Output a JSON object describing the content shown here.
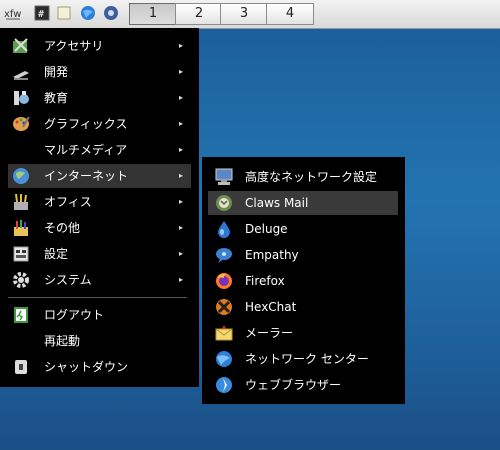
{
  "taskbar": {
    "launchers": [
      {
        "icon": "whisker-menu-icon"
      },
      {
        "icon": "terminal-icon"
      },
      {
        "icon": "file-manager-icon"
      },
      {
        "icon": "web-browser-icon"
      },
      {
        "icon": "settings-icon"
      }
    ],
    "workspaces": [
      {
        "label": "1",
        "active": true
      },
      {
        "label": "2",
        "active": false
      },
      {
        "label": "3",
        "active": false
      },
      {
        "label": "4",
        "active": false
      }
    ]
  },
  "main_menu": {
    "items": [
      {
        "label": "アクセサリ",
        "icon": "accessories-icon",
        "submenu": true
      },
      {
        "label": "開発",
        "icon": "development-icon",
        "submenu": true
      },
      {
        "label": "教育",
        "icon": "education-icon",
        "submenu": true
      },
      {
        "label": "グラフィックス",
        "icon": "graphics-icon",
        "submenu": true
      },
      {
        "label": "マルチメディア",
        "icon": "",
        "submenu": true
      },
      {
        "label": "インターネット",
        "icon": "internet-icon",
        "submenu": true,
        "highlighted": true
      },
      {
        "label": "オフィス",
        "icon": "office-icon",
        "submenu": true
      },
      {
        "label": "その他",
        "icon": "other-icon",
        "submenu": true
      },
      {
        "label": "設定",
        "icon": "settings-icon",
        "submenu": true
      },
      {
        "label": "システム",
        "icon": "system-icon",
        "submenu": true
      }
    ],
    "session": [
      {
        "label": "ログアウト",
        "icon": "logout-icon"
      },
      {
        "label": "再起動",
        "icon": ""
      },
      {
        "label": "シャットダウン",
        "icon": "shutdown-icon"
      }
    ],
    "arrow": "▸"
  },
  "internet_submenu": {
    "items": [
      {
        "label": "高度なネットワーク設定",
        "icon": "network-settings-icon"
      },
      {
        "label": "Claws Mail",
        "icon": "claws-mail-icon",
        "highlighted": true
      },
      {
        "label": "Deluge",
        "icon": "deluge-icon"
      },
      {
        "label": "Empathy",
        "icon": "empathy-icon"
      },
      {
        "label": "Firefox",
        "icon": "firefox-icon"
      },
      {
        "label": "HexChat",
        "icon": "hexchat-icon"
      },
      {
        "label": "メーラー",
        "icon": "mailer-icon"
      },
      {
        "label": "ネットワーク センター",
        "icon": "network-center-icon"
      },
      {
        "label": "ウェブブラウザー",
        "icon": "web-browser-icon"
      }
    ]
  }
}
